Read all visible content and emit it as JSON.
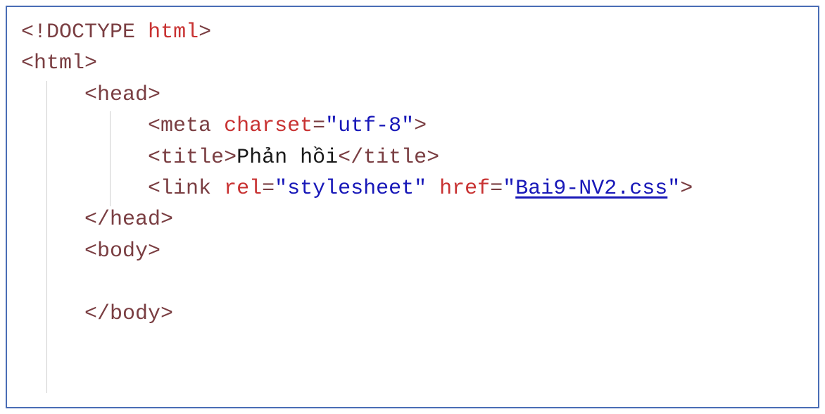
{
  "code": {
    "line1": {
      "p1": "<!",
      "kw1": "DOCTYPE",
      "sp1": " ",
      "kw2": "html",
      "p2": ">"
    },
    "line2": {
      "p1": "<",
      "tag": "html",
      "p2": ">"
    },
    "line3": {
      "indent": "     ",
      "p1": "<",
      "tag": "head",
      "p2": ">"
    },
    "line4": {
      "indent": "          ",
      "p1": "<",
      "tag": "meta",
      "sp1": " ",
      "attr": "charset",
      "eq": "=",
      "val": "\"utf-8\"",
      "p2": ">"
    },
    "line5": {
      "indent": "          ",
      "p1": "<",
      "tag": "title",
      "p2": ">",
      "text": "Phản hồi",
      "p3": "</",
      "tag2": "title",
      "p4": ">"
    },
    "line6": {
      "indent": "          ",
      "p1": "<",
      "tag": "link",
      "sp1": " ",
      "attr1": "rel",
      "eq1": "=",
      "val1": "\"stylesheet\"",
      "sp2": " ",
      "attr2": "href",
      "eq2": "=",
      "q1": "\"",
      "linkval": "Bai9-NV2.css",
      "q2": "\"",
      "p2": ">"
    },
    "line7": {
      "indent": "     ",
      "p1": "</",
      "tag": "head",
      "p2": ">"
    },
    "line8": {
      "indent": "     ",
      "p1": "<",
      "tag": "body",
      "p2": ">"
    },
    "line9": {
      "indent": "     ",
      "content": ""
    },
    "line10": {
      "indent": "     ",
      "p1": "</",
      "tag": "body",
      "p2": ">"
    }
  }
}
